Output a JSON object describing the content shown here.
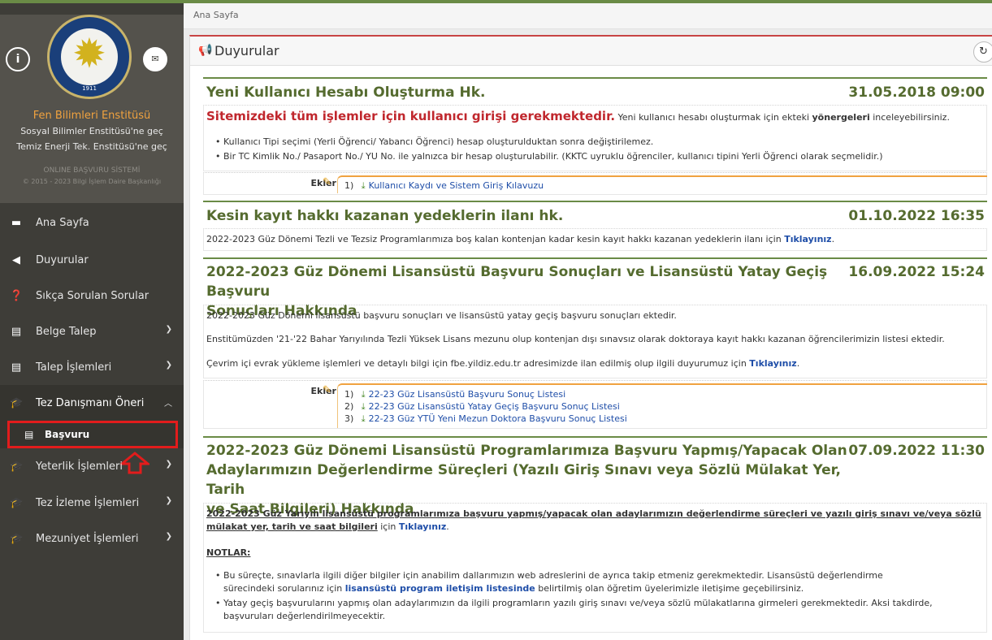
{
  "sidebar": {
    "institute_name": "Fen Bilimleri Enstitüsü",
    "link_social": "Sosyal Bilimler Enstitüsü'ne geç",
    "link_energy": "Temiz Enerji Tek. Enstitüsü'ne geç",
    "system_name": "ONLINE BAŞVURU SİSTEMİ",
    "copyright": "© 2015 - 2023 Bilgi İşlem Daire Başkanlığı",
    "logo_year": "1911",
    "items": [
      {
        "label": "Ana Sayfa",
        "icon": "monitor-icon"
      },
      {
        "label": "Duyurular",
        "icon": "bullhorn-icon"
      },
      {
        "label": "Sıkça Sorulan Sorular",
        "icon": "question-icon"
      },
      {
        "label": "Belge Talep",
        "icon": "document-icon"
      },
      {
        "label": "Talep İşlemleri",
        "icon": "document-icon"
      },
      {
        "label": "Tez Danışmanı Öneri",
        "icon": "graduation-cap-icon"
      },
      {
        "label": "Başvuru",
        "icon": "document-icon"
      },
      {
        "label": "Yeterlik İşlemleri",
        "icon": "graduation-cap-icon"
      },
      {
        "label": "Tez İzleme İşlemleri",
        "icon": "graduation-cap-icon"
      },
      {
        "label": "Mezuniyet İşlemleri",
        "icon": "graduation-cap-icon"
      }
    ]
  },
  "breadcrumb": "Ana Sayfa",
  "panel_title": "Duyurular",
  "ekler_label": "Ekler",
  "announcements": [
    {
      "title": "Yeni Kullanıcı Hesabı Oluşturma Hk.",
      "date": "31.05.2018 09:00",
      "lead_red": "Sitemizdeki tüm işlemler için kullanıcı girişi gerekmektedir.",
      "lead_text": " Yeni kullanıcı hesabı oluşturmak için ekteki ",
      "lead_bold": "yönergeleri",
      "lead_tail": " inceleyebilirsiniz.",
      "bullets": [
        "Kullanıcı Tipi seçimi (Yerli Öğrenci/ Yabancı Öğrenci) hesap oluşturulduktan sonra değiştirilemez.",
        "Bir TC Kimlik No./ Pasaport No./ YU No. ile yalnızca bir hesap oluşturulabilir. (KKTC uyruklu öğrenciler, kullanıcı tipini Yerli Öğrenci olarak seçmelidir.)"
      ],
      "attachments": [
        "Kullanıcı Kaydı ve Sistem Giriş Kılavuzu"
      ]
    },
    {
      "title": "Kesin kayıt hakkı kazanan yedeklerin ilanı hk.",
      "date": "01.10.2022 16:35",
      "text": "2022-2023 Güz Dönemi Tezli ve Tezsiz Programlarımıza boş kalan kontenjan kadar kesin kayıt hakkı kazanan yedeklerin ilanı için ",
      "link": "Tıklayınız",
      "tail": "."
    },
    {
      "title_line1": "2022-2023 Güz Dönemi Lisansüstü Başvuru Sonuçları ve Lisansüstü Yatay Geçiş Başvuru",
      "title_line2": "Sonuçları Hakkında",
      "date": "16.09.2022 15:24",
      "p1": "2022-2023 Güz Dönemi lisansüstü başvuru sonuçları ve lisansüstü yatay geçiş başvuru sonuçları ektedir.",
      "p2": "Enstitümüzden '21-'22 Bahar Yarıyılında Tezli Yüksek Lisans mezunu olup kontenjan dışı sınavsız olarak doktoraya kayıt hakkı kazanan öğrencilerimizin listesi ektedir.",
      "p3": "Çevrim içi evrak yükleme işlemleri ve detaylı bilgi için fbe.yildiz.edu.tr adresimizde ilan edilmiş olup ilgili duyurumuz için ",
      "p3_link": "Tıklayınız",
      "p3_tail": ".",
      "attachments": [
        "22-23 Güz Lisansüstü Başvuru Sonuç Listesi",
        "22-23 Güz Lisansüstü Yatay Geçiş Başvuru Sonuç Listesi",
        "22-23 Güz YTÜ Yeni Mezun Doktora Başvuru Sonuç Listesi"
      ]
    },
    {
      "title_line1": "2022-2023 Güz Dönemi Lisansüstü Programlarımıza Başvuru Yapmış/Yapacak Olan",
      "title_line2": "Adaylarımızın Değerlendirme Süreçleri (Yazılı Giriş Sınavı veya Sözlü Mülakat Yer, Tarih",
      "title_line3": "ve Saat Bilgileri) Hakkında",
      "date": "07.09.2022 11:30",
      "u_line1": "2022-2023 Güz Yarıyılı lisansüstü programlarımıza başvuru yapmış/yapacak olan adaylarımızın değerlendirme süreçleri ve yazılı giriş sınavı ve/veya sözlü",
      "u_line2": "mülakat yer, tarih ve saat bilgileri",
      "u_mid": " için ",
      "u_link": "Tıklayınız",
      "u_tail": ".",
      "notlar": "NOTLAR:",
      "b1_line1": "Bu süreçte, sınavlarla ilgili diğer bilgiler için anabilim dallarımızın web adreslerini de ayrıca takip etmeniz gerekmektedir. Lisansüstü değerlendirme",
      "b1_line2a": "sürecindeki sorularınız için ",
      "b1_link": "lisansüstü program iletişim listesinde",
      "b1_line2b": " belirtilmiş olan öğretim üyelerimizle iletişime geçebilirsiniz.",
      "b2_line1": "Yatay geçiş başvurularını yapmış olan adaylarımızın da ilgili programların yazılı giriş sınavı ve/veya sözlü mülakatlarına girmeleri gerekmektedir. Aksi takdirde,",
      "b2_line2": "başvuruları değerlendirilmeyecektir."
    }
  ],
  "colors": {
    "accent_green": "#6a8b46",
    "title_green": "#556b2f",
    "red": "#c0272d",
    "link_blue": "#1f4ea8",
    "orange": "#f0a23f"
  }
}
